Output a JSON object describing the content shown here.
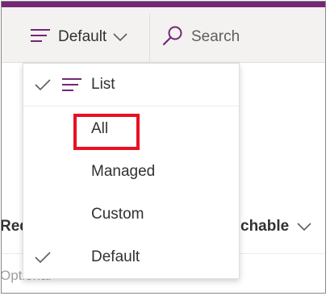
{
  "colors": {
    "accent": "#742774",
    "command_bar_bg": "#f3f2f1",
    "highlight_box": "#e81123"
  },
  "command_bar": {
    "view_selector": {
      "label": "Default",
      "icon": "view-lines-icon",
      "dropdown_icon": "chevron-down-icon"
    },
    "search": {
      "label": "Search",
      "icon": "search-icon"
    }
  },
  "background": {
    "column_required_partial": "Req",
    "column_searchable_partial": "chable",
    "cell_optional_partial": "Optional"
  },
  "view_menu": {
    "list_option": {
      "label": "List",
      "checked": true,
      "icon": "list-lines-icon"
    },
    "filter_options": [
      {
        "label": "All",
        "checked": false,
        "highlighted": true
      },
      {
        "label": "Managed",
        "checked": false
      },
      {
        "label": "Custom",
        "checked": false
      },
      {
        "label": "Default",
        "checked": true
      }
    ]
  }
}
